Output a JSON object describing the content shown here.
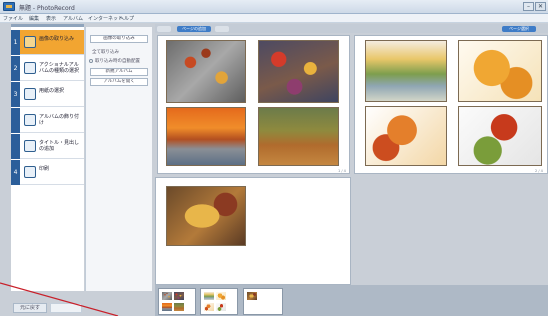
{
  "window": {
    "title": "無題 - PhotoRecord"
  },
  "menubar": {
    "items": [
      "ファイル",
      "編集",
      "表示",
      "アルバム",
      "インターネット",
      "ヘルプ"
    ]
  },
  "steps": [
    {
      "num": "1",
      "label": "画像の取り込み",
      "active": true
    },
    {
      "num": "2",
      "label": "アクショナルアルバムの種類の選択",
      "active": false
    },
    {
      "num": "3",
      "label": "用紙の選択",
      "active": false
    },
    {
      "num": "",
      "label": "アルバムの飾り付け",
      "active": false
    },
    {
      "num": "",
      "label": "タイトル・見出しの追加",
      "active": false
    },
    {
      "num": "4",
      "label": "印刷",
      "active": false
    }
  ],
  "sidebar_bottom": {
    "back_label": "元に戻す"
  },
  "options": {
    "import_button": "画像の取り込み",
    "import_all": "全て取り込み",
    "auto_layout": "取り込み時の自動配置",
    "album_button": "新規アルバム",
    "open_button": "アルバムを開く"
  },
  "toolbar": {
    "left_button": "ページの追加",
    "right_button": "ページ選択"
  },
  "pages": [
    {
      "num": "1 / 4"
    },
    {
      "num": "2 / 4"
    }
  ],
  "colors": {
    "accent": "#f2a531",
    "step_blue": "#2b5e9a",
    "toolbar_blue": "#3e7cc7"
  },
  "icons": [
    "import-icon",
    "album-type-icon",
    "paper-icon",
    "decorate-icon",
    "title-icon",
    "print-icon"
  ]
}
